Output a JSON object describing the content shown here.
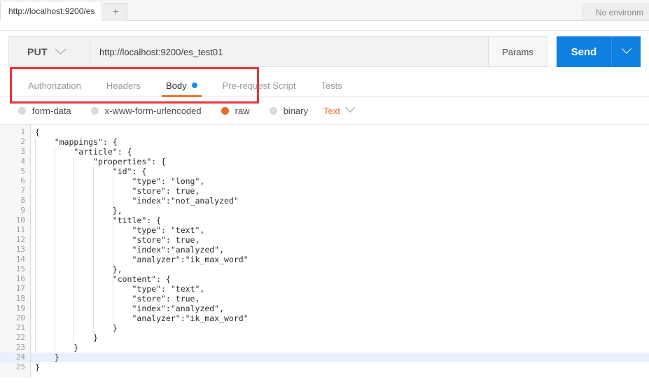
{
  "window": {
    "tab_label": "http://localhost:9200/es",
    "new_tab_icon": "plus-icon",
    "environment_label": "No environm"
  },
  "request": {
    "method": "PUT",
    "method_chevron_icon": "chevron-down-icon",
    "url": "http://localhost:9200/es_test01",
    "params_label": "Params",
    "send_label": "Send",
    "send_chevron_icon": "chevron-down-icon"
  },
  "annotation": {
    "color": "#e8333a",
    "target": "method-and-url"
  },
  "section_tabs": [
    {
      "label": "Authorization",
      "active": false,
      "dot": false
    },
    {
      "label": "Headers",
      "active": false,
      "dot": false
    },
    {
      "label": "Body",
      "active": true,
      "dot": true
    },
    {
      "label": "Pre-request Script",
      "active": false,
      "dot": false
    },
    {
      "label": "Tests",
      "active": false,
      "dot": false
    }
  ],
  "body_types": [
    {
      "label": "form-data",
      "selected": false
    },
    {
      "label": "x-www-form-urlencoded",
      "selected": false
    },
    {
      "label": "raw",
      "selected": true
    },
    {
      "label": "binary",
      "selected": false
    }
  ],
  "format_select": {
    "value": "Text",
    "chevron_icon": "chevron-down-icon"
  },
  "colors": {
    "accent_orange": "#e8762a",
    "send_blue": "#0f7fe0",
    "dot_blue": "#1a8cf0",
    "annotation_red": "#e8333a",
    "active_line": "#e8f0fb"
  },
  "editor": {
    "active_line": 24,
    "line_numbers": [
      1,
      2,
      3,
      4,
      5,
      6,
      7,
      8,
      9,
      10,
      11,
      12,
      13,
      14,
      15,
      16,
      17,
      18,
      19,
      20,
      21,
      22,
      23,
      24,
      25
    ],
    "lines": [
      "{",
      "    \"mappings\": {",
      "        \"article\": {",
      "            \"properties\": {",
      "                \"id\": {",
      "                    \"type\": \"long\",",
      "                    \"store\": true,",
      "                    \"index\":\"not_analyzed\"",
      "                },",
      "                \"title\": {",
      "                    \"type\": \"text\",",
      "                    \"store\": true,",
      "                    \"index\":\"analyzed\",",
      "                    \"analyzer\":\"ik_max_word\"",
      "                },",
      "                \"content\": {",
      "                    \"type\": \"text\",",
      "                    \"store\": true,",
      "                    \"index\":\"analyzed\",",
      "                    \"analyzer\":\"ik_max_word\"",
      "                }",
      "            }",
      "        }",
      "    }",
      "}"
    ]
  }
}
